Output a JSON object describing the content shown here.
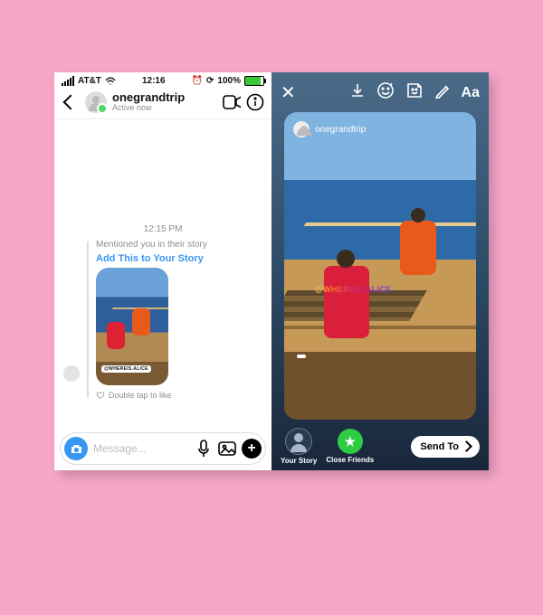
{
  "status": {
    "carrier": "AT&T",
    "time": "12:16",
    "battery": "100%"
  },
  "dm": {
    "username": "onegrandtrip",
    "active": "Active now",
    "timestamp": "12:15 PM",
    "mention_line": "Mentioned you in their story",
    "add_link": "Add This to Your Story",
    "double_tap": "Double tap to like",
    "placeholder": "Message...",
    "tag_handle": "@WHEREIS.ALICE"
  },
  "story": {
    "attributed_user": "onegrandtrip",
    "tag_handle": "@WHEREIS.ALICE",
    "text_tool": "Aa",
    "your_story": "Your Story",
    "close_friends": "Close Friends",
    "send_to": "Send To"
  }
}
